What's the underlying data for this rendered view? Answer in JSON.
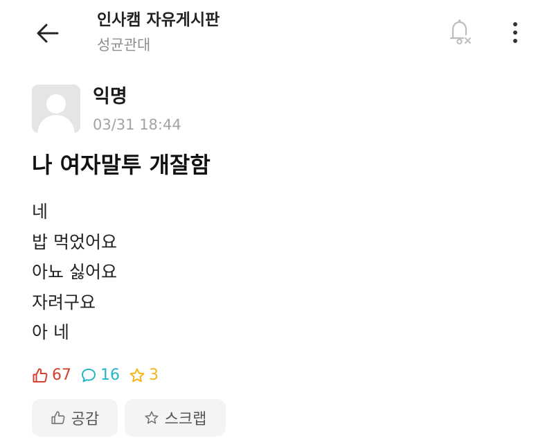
{
  "header": {
    "board_title": "인사캠 자유게시판",
    "school_name": "성균관대",
    "icons": {
      "back": "back-arrow-icon",
      "bell": "notification-bell-off-icon",
      "more": "more-vertical-icon"
    }
  },
  "post": {
    "author": "익명",
    "time": "03/31 18:44",
    "title": "나 여자말투 개잘함",
    "body_lines": [
      "네",
      "밥 먹었어요",
      "아뇨 싫어요",
      "자려구요",
      "아 네"
    ]
  },
  "stats": {
    "likes": "67",
    "comments": "16",
    "scraps": "3"
  },
  "actions": {
    "like_label": "공감",
    "scrap_label": "스크랩"
  },
  "colors": {
    "like": "#d4402f",
    "comment": "#25b5c9",
    "scrap": "#f2b619",
    "button_bg": "#f4f4f4"
  }
}
